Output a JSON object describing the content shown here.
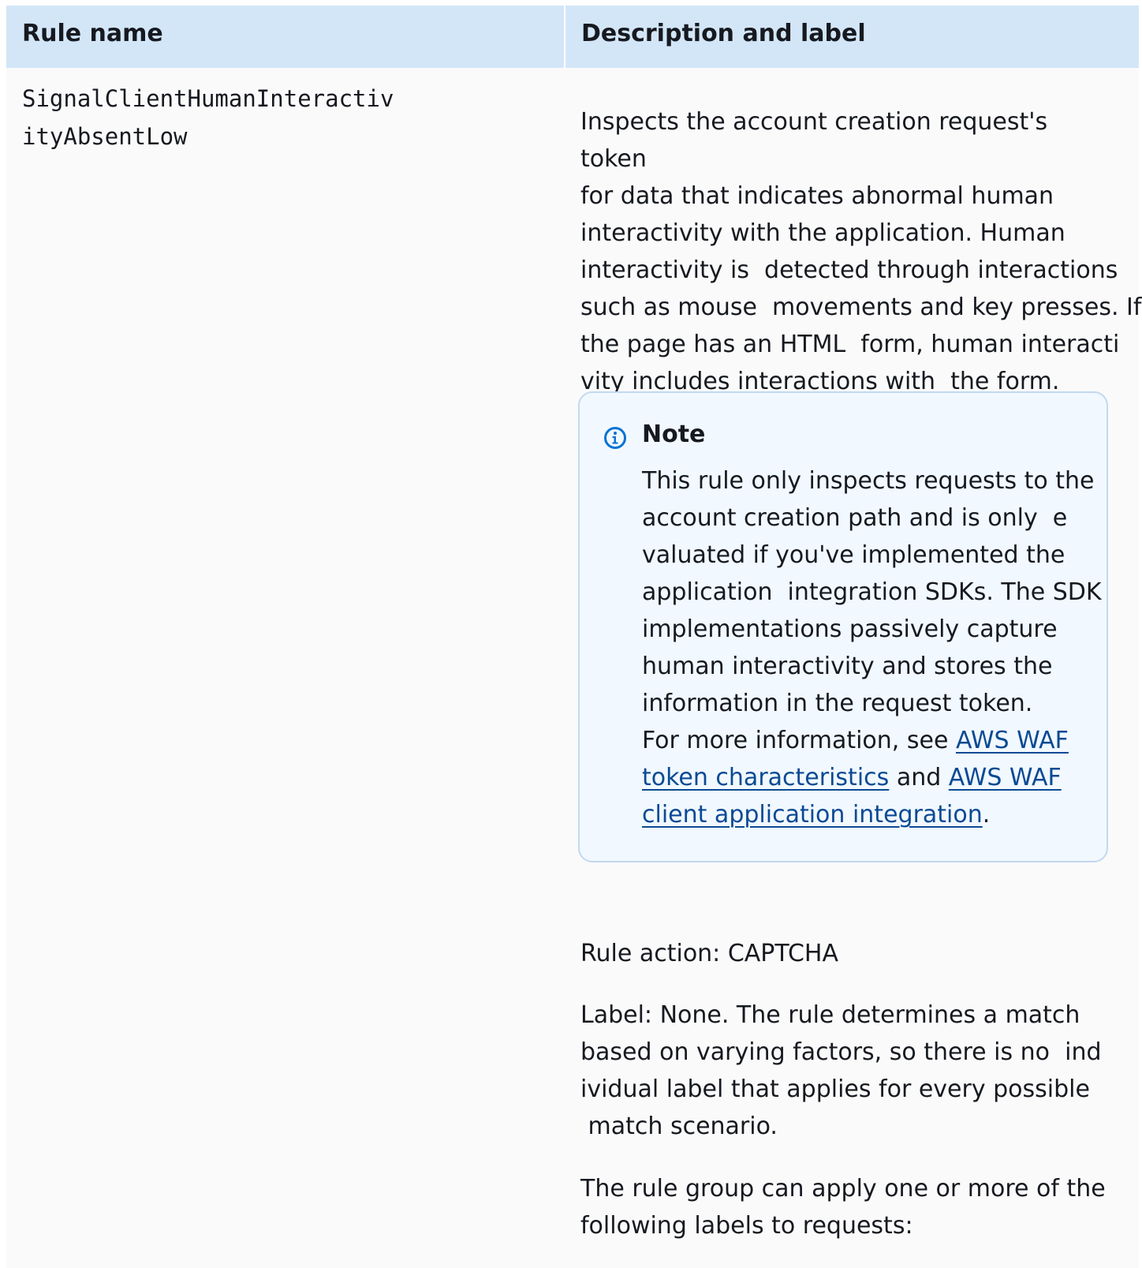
{
  "table": {
    "headers": {
      "rule_name": "Rule name",
      "description_and_label": "Description and label"
    },
    "row": {
      "rule_name_line1": "SignalClientHumanInteractiv",
      "rule_name_line2": "ityAbsentLow",
      "description_lines": [
        "Inspects the account creation request's token",
        "for data that indicates abnormal human",
        "interactivity with the application. Human",
        "interactivity is  detected through interactions",
        "such as mouse  movements and key presses. If",
        "the page has an HTML  form, human interacti",
        "vity includes interactions with  the form."
      ],
      "note": {
        "icon": "info-icon",
        "title": "Note",
        "body_lines": [
          "This rule only inspects requests to the",
          "account creation path and is only  e",
          "valuated if you've implemented the",
          "application  integration SDKs. The SDK",
          "implementations passively capture",
          "human interactivity and stores the",
          "information in the request token."
        ],
        "more_info_prefix": "For more information, see ",
        "link1_line1": "AWS WAF",
        "link1_line2": "token characteristics",
        "and_text": " and ",
        "link2_line1": "AWS WAF",
        "link2_line2": "client application integration",
        "period": "."
      },
      "rule_action": "Rule action: CAPTCHA",
      "label_lines": [
        "Label: None. The rule determines a match",
        "based on varying factors, so there is no  ind",
        "ividual label that applies for every possible",
        " match scenario."
      ],
      "group_lines": [
        "The rule group can apply one or more of the",
        "following labels to requests:"
      ]
    }
  },
  "colors": {
    "header_bg": "#d3e6f8",
    "cell_bg": "#fafafa",
    "note_bg": "#f1f8ff",
    "note_border": "#c2d9ef",
    "link": "#0a4a94",
    "info_icon": "#0972d3"
  }
}
